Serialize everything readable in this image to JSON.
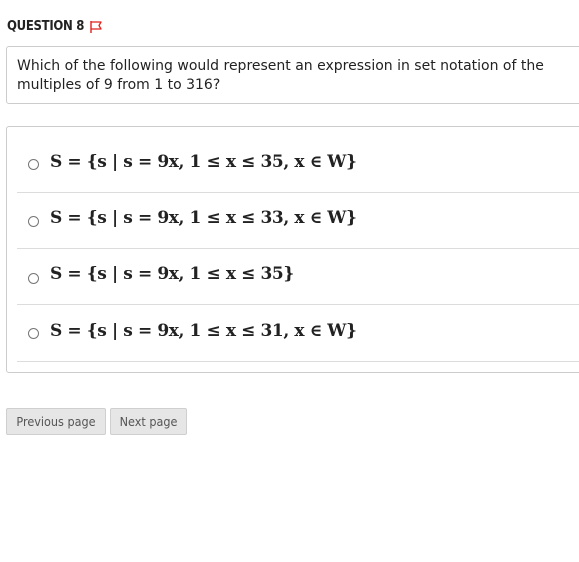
{
  "question": {
    "header": "QUESTION 8",
    "flag_icon": "flag-icon",
    "flag_color": "#e0231e",
    "text": "Which of the following would represent an expression in set notation of the multiples of 9 from 1 to 316?"
  },
  "options": [
    {
      "expression": "S = {s | s = 9x, 1 ≤ x ≤ 35, x ∈ W}",
      "selected": false
    },
    {
      "expression": "S = {s | s = 9x, 1 ≤ x ≤ 33, x ∈ W}",
      "selected": false
    },
    {
      "expression": "S = {s | s = 9x, 1 ≤ x ≤ 35}",
      "selected": false
    },
    {
      "expression": "S = {s | s = 9x, 1 ≤ x ≤ 31, x ∈ W}",
      "selected": false
    }
  ],
  "navigation": {
    "previous_label": "Previous page",
    "next_label": "Next page"
  }
}
